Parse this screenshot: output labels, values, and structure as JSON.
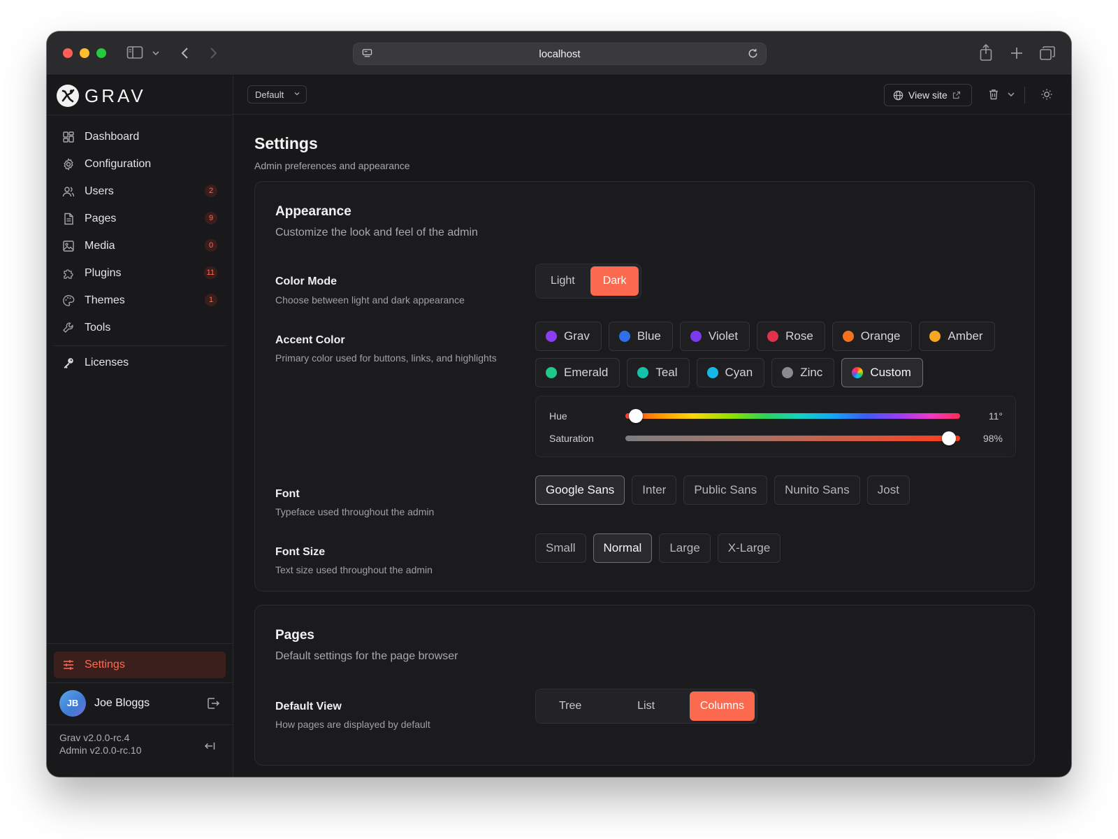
{
  "browser": {
    "url": "localhost",
    "icons": {
      "sidebar_toggle": "sidebar-icon",
      "back": "chevron-left-icon",
      "forward": "chevron-right-icon",
      "share": "share-icon",
      "new_tab": "plus-icon",
      "tabs": "tabs-icon"
    }
  },
  "brand": {
    "name": "GRAV"
  },
  "sidebar": {
    "items": [
      {
        "label": "Dashboard",
        "icon": "dashboard-icon",
        "badge": ""
      },
      {
        "label": "Configuration",
        "icon": "gear-icon",
        "badge": ""
      },
      {
        "label": "Users",
        "icon": "users-icon",
        "badge": "2"
      },
      {
        "label": "Pages",
        "icon": "page-icon",
        "badge": "9"
      },
      {
        "label": "Media",
        "icon": "image-icon",
        "badge": "0"
      },
      {
        "label": "Plugins",
        "icon": "puzzle-icon",
        "badge": "11"
      },
      {
        "label": "Themes",
        "icon": "palette-icon",
        "badge": "1"
      },
      {
        "label": "Tools",
        "icon": "wrench-icon",
        "badge": ""
      }
    ],
    "licenses": "Licenses",
    "settings": "Settings",
    "user": {
      "initials": "JB",
      "name": "Joe Bloggs"
    },
    "version_grav": "Grav v2.0.0-rc.4",
    "version_admin": "Admin v2.0.0-rc.10"
  },
  "topbar": {
    "environment": "Default",
    "view_site": "View site"
  },
  "page": {
    "title": "Settings",
    "subtitle": "Admin preferences and appearance"
  },
  "appearance": {
    "title": "Appearance",
    "subtitle": "Customize the look and feel of the admin",
    "color_mode": {
      "label": "Color Mode",
      "desc": "Choose between light and dark appearance",
      "options": [
        "Light",
        "Dark"
      ],
      "selected": "Dark"
    },
    "accent": {
      "label": "Accent Color",
      "desc": "Primary color used for buttons, links, and highlights",
      "row1": [
        {
          "name": "Grav",
          "color": "#8b3df2"
        },
        {
          "name": "Blue",
          "color": "#2f6fe8"
        },
        {
          "name": "Violet",
          "color": "#7c3aed"
        },
        {
          "name": "Rose",
          "color": "#e0314f"
        },
        {
          "name": "Orange",
          "color": "#f57320"
        },
        {
          "name": "Amber",
          "color": "#f5a623"
        }
      ],
      "row2": [
        {
          "name": "Emerald",
          "color": "#1fc98a"
        },
        {
          "name": "Teal",
          "color": "#16c2a8"
        },
        {
          "name": "Cyan",
          "color": "#15b8e6"
        },
        {
          "name": "Zinc",
          "color": "#8a8a90"
        },
        {
          "name": "Custom",
          "color": "conic"
        }
      ],
      "selected": "Custom",
      "hue": {
        "label": "Hue",
        "value": 11,
        "max": 360,
        "display": "11°"
      },
      "saturation": {
        "label": "Saturation",
        "value": 98,
        "max": 100,
        "display": "98%"
      }
    },
    "font": {
      "label": "Font",
      "desc": "Typeface used throughout the admin",
      "options": [
        "Google Sans",
        "Inter",
        "Public Sans",
        "Nunito Sans",
        "Jost"
      ],
      "selected": "Google Sans"
    },
    "font_size": {
      "label": "Font Size",
      "desc": "Text size used throughout the admin",
      "options": [
        "Small",
        "Normal",
        "Large",
        "X-Large"
      ],
      "selected": "Normal"
    }
  },
  "pages": {
    "title": "Pages",
    "subtitle": "Default settings for the page browser",
    "default_view": {
      "label": "Default View",
      "desc": "How pages are displayed by default",
      "options": [
        "Tree",
        "List",
        "Columns"
      ],
      "selected": "Columns"
    }
  },
  "colors": {
    "accent": "#fb6a4f",
    "badge_text": "#ff6a55"
  }
}
